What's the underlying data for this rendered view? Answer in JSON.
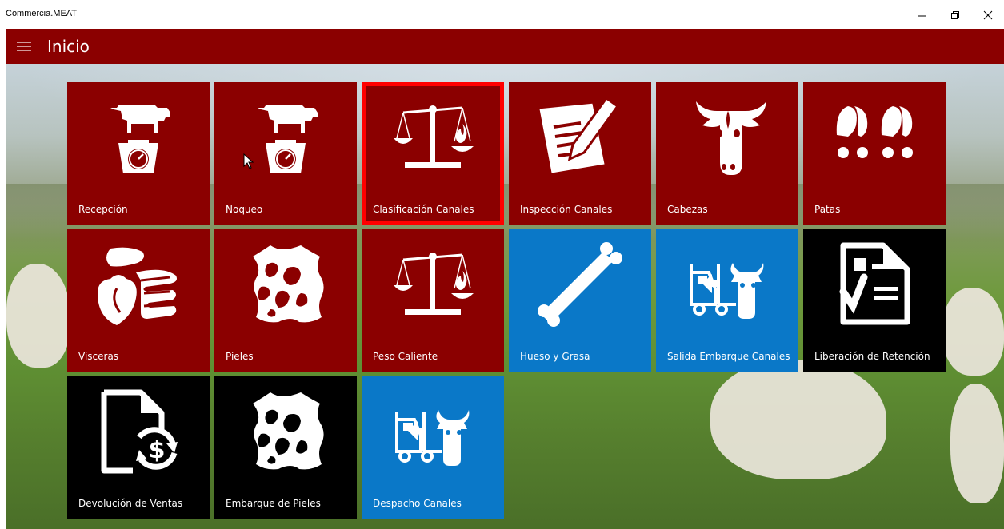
{
  "window": {
    "title": "Commercia.MEAT",
    "controls": [
      "minimize",
      "restore",
      "close"
    ]
  },
  "header": {
    "menu_icon": "hamburger-icon",
    "title": "Inicio",
    "color": "#8b0000"
  },
  "colors": {
    "tile_red": "#8b0000",
    "tile_blue": "#0a78c8",
    "tile_black": "#000000",
    "selection": "#ff0000"
  },
  "tiles": [
    {
      "label": "Recepción",
      "icon": "cow-on-scale-icon",
      "color": "red"
    },
    {
      "label": "Noqueo",
      "icon": "cow-on-scale-icon",
      "color": "red"
    },
    {
      "label": "Clasificación Canales",
      "icon": "balance-scale-fire-icon",
      "color": "red",
      "selected": true
    },
    {
      "label": "Inspección Canales",
      "icon": "document-pencil-icon",
      "color": "red"
    },
    {
      "label": "Cabezas",
      "icon": "cow-head-icon",
      "color": "red"
    },
    {
      "label": "Patas",
      "icon": "hoof-prints-icon",
      "color": "red"
    },
    {
      "label": "Visceras",
      "icon": "viscera-icon",
      "color": "red"
    },
    {
      "label": "Pieles",
      "icon": "hide-icon",
      "color": "red"
    },
    {
      "label": "Peso Caliente",
      "icon": "balance-scale-fire-icon",
      "color": "red"
    },
    {
      "label": "Hueso y Grasa",
      "icon": "bone-icon",
      "color": "blue"
    },
    {
      "label": "Salida Embarque Canales",
      "icon": "forklift-cow-icon",
      "color": "blue"
    },
    {
      "label": "Liberación de Retención",
      "icon": "checklist-document-icon",
      "color": "black"
    },
    {
      "label": "Devolución de Ventas",
      "icon": "document-refund-icon",
      "color": "black"
    },
    {
      "label": "Embarque de Pieles",
      "icon": "hide-icon",
      "color": "black"
    },
    {
      "label": "Despacho Canales",
      "icon": "forklift-cow-icon",
      "color": "blue"
    }
  ]
}
